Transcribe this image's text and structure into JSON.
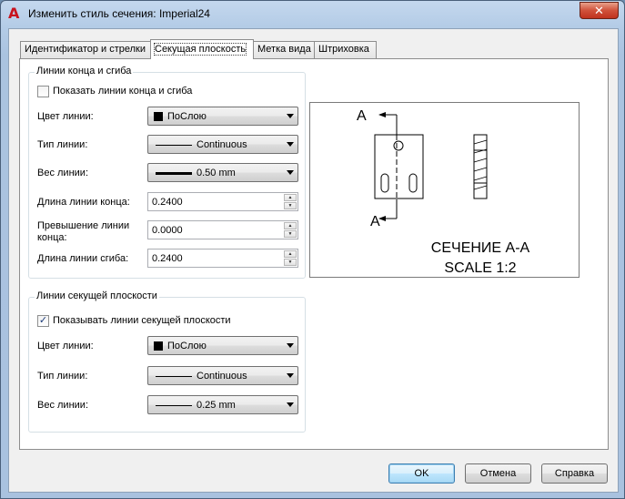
{
  "window": {
    "title": "Изменить стиль сечения: Imperial24",
    "close_glyph": "✕"
  },
  "tabs": [
    {
      "label": "Идентификатор и стрелки",
      "active": false
    },
    {
      "label": "Секущая плоскость",
      "active": true
    },
    {
      "label": "Метка вида",
      "active": false
    },
    {
      "label": "Штриховка",
      "active": false
    }
  ],
  "end_bend": {
    "title": "Линии конца и сгиба",
    "show": {
      "label": "Показать линии конца и сгиба",
      "checked": false
    },
    "color": {
      "label": "Цвет линии:",
      "value": "ПоСлою"
    },
    "linetype": {
      "label": "Тип линии:",
      "value": "Continuous"
    },
    "lineweight": {
      "label": "Вес линии:",
      "value": "0.50 mm"
    },
    "end_length": {
      "label": "Длина линии конца:",
      "value": "0.2400"
    },
    "overshoot": {
      "label_line1": "Превышение линии",
      "label_line2": "конца:",
      "value": "0.0000"
    },
    "bend_length": {
      "label": "Длина линии сгиба:",
      "value": "0.2400"
    }
  },
  "plane_lines": {
    "title": "Линии секущей плоскости",
    "show": {
      "label": "Показывать линии секущей плоскости",
      "checked": true,
      "check_glyph": "✓"
    },
    "color": {
      "label": "Цвет линии:",
      "value": "ПоСлою"
    },
    "linetype": {
      "label": "Тип линии:",
      "value": "Continuous"
    },
    "lineweight": {
      "label": "Вес линии:",
      "value": "0.25 mm"
    }
  },
  "preview": {
    "marker_top": "A",
    "marker_bottom": "A",
    "caption_line1": "СЕЧЕНИЕ А-А",
    "caption_line2": "SCALE 1:2"
  },
  "buttons": {
    "ok": "OK",
    "cancel": "Отмена",
    "help": "Справка"
  }
}
